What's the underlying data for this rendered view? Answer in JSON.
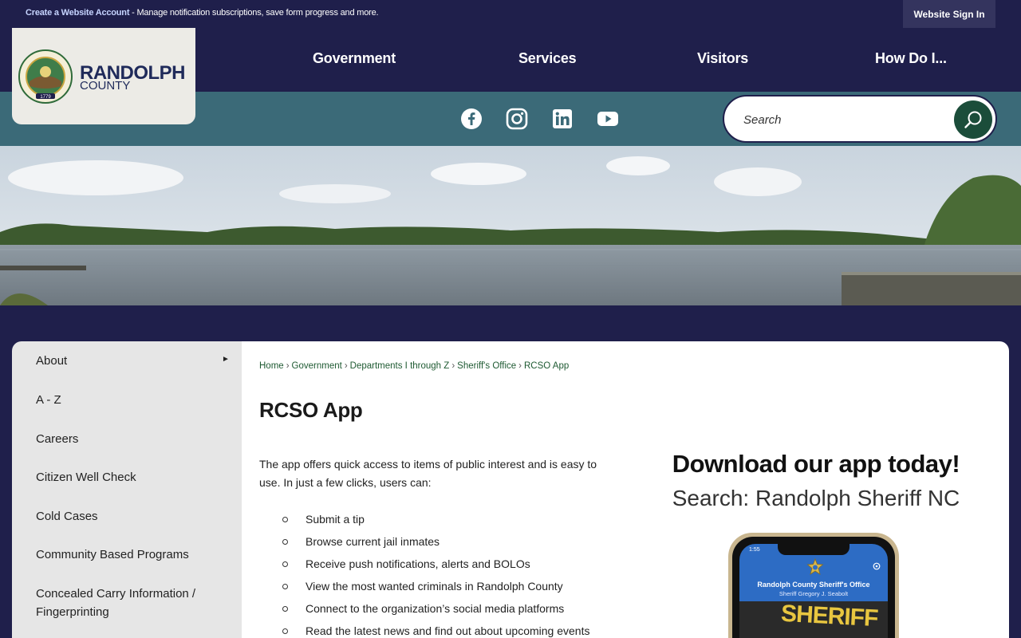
{
  "topbar": {
    "create_link": "Create a Website Account",
    "notice_text": " - Manage notification subscriptions, save form progress and more.",
    "signin": "Website Sign In"
  },
  "logo": {
    "seal_text": "RANDOLPH COUNTY NORTH CAROLINA",
    "seal_year": "1779",
    "name": "RANDOLPH",
    "sub": "COUNTY"
  },
  "nav": [
    "Government",
    "Services",
    "Visitors",
    "How Do I..."
  ],
  "social": [
    "facebook-icon",
    "instagram-icon",
    "linkedin-icon",
    "youtube-icon"
  ],
  "search": {
    "placeholder": "Search"
  },
  "sidebar": {
    "items": [
      "About",
      "A - Z",
      "Careers",
      "Citizen Well Check",
      "Cold Cases",
      "Community Based Programs",
      "Concealed Carry Information / Fingerprinting"
    ],
    "arrow": "►"
  },
  "breadcrumbs": [
    "Home",
    "Government",
    "Departments I through Z",
    "Sheriff's Office",
    "RCSO App"
  ],
  "breadcrumb_sep": "›",
  "page": {
    "title": "RCSO App",
    "intro": "The app offers quick access to items of public interest and is easy to use. In just a few clicks, users can:",
    "bullets": [
      "Submit a tip",
      "Browse current jail inmates",
      "Receive push notifications, alerts and BOLOs",
      "View the most wanted criminals in Randolph County",
      "Connect to the organization’s social media platforms",
      "Read the latest news and find out about upcoming events"
    ]
  },
  "promo": {
    "headline": "Download our app today!",
    "subline": "Search: Randolph Sheriff NC",
    "phone_time": "1:55",
    "app_title": "Randolph County Sheriff's Office",
    "app_subtitle": "Sheriff Gregory J. Seabolt",
    "sheriff_word": "SHERIFF"
  },
  "colors": {
    "navy": "#1f1f4b",
    "teal": "#3b6a78",
    "search_button": "#1b4d3a",
    "link_green": "#1e5a32"
  }
}
